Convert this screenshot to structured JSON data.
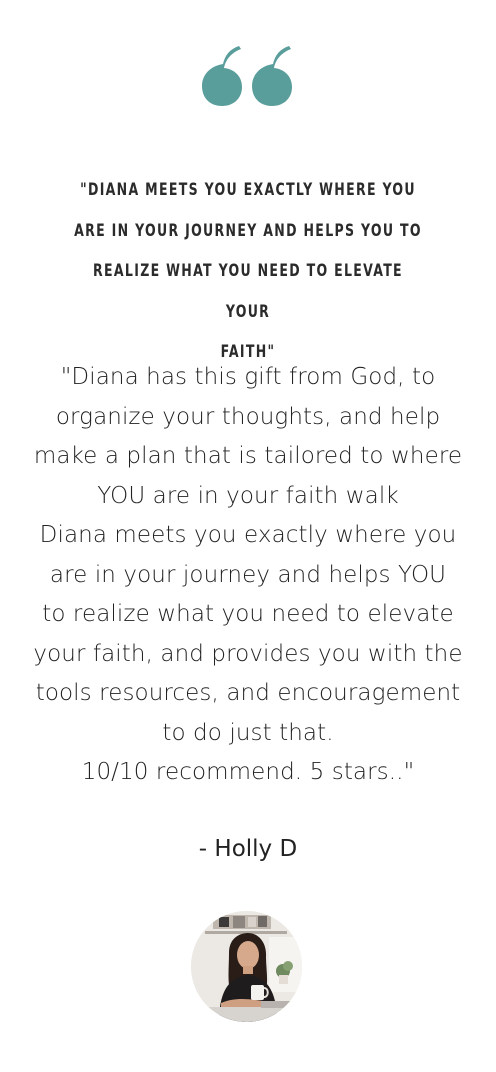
{
  "colors": {
    "accent": "#5a9e9c",
    "text": "#222222"
  },
  "quote_icon": "double-quote-icon",
  "headline": {
    "lines": [
      "\"DIANA MEETS YOU EXACTLY WHERE YOU",
      "ARE IN YOUR JOURNEY AND HELPS YOU TO",
      "REALIZE WHAT YOU NEED TO ELEVATE YOUR",
      "FAITH\""
    ]
  },
  "testimonial": {
    "lines": [
      "\"Diana has this gift from God, to",
      "organize your thoughts, and help",
      "make a plan that is tailored to where",
      "YOU are in your faith walk",
      "Diana meets you exactly where you",
      "are in your journey and helps YOU",
      "to realize what you need to elevate",
      "your faith, and provides you with the",
      "tools resources, and encouragement",
      "to do just that.",
      "10/10 recommend. 5 stars..\""
    ]
  },
  "author": {
    "name": "- Holly D"
  },
  "avatar": {
    "icon": "avatar-photo"
  }
}
